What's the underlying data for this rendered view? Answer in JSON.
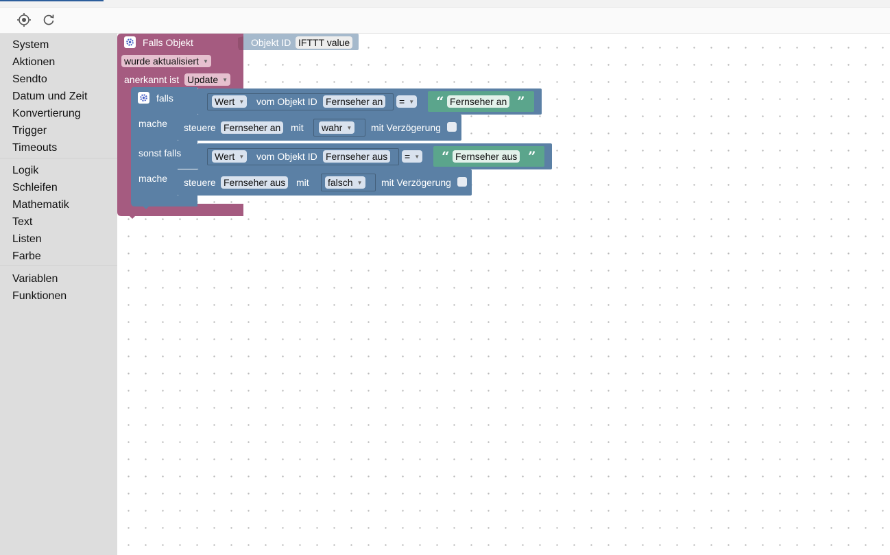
{
  "toolbar": {
    "icons": [
      "crosshair-icon",
      "refresh-icon"
    ]
  },
  "sidebar": {
    "groups": [
      [
        "System",
        "Aktionen",
        "Sendto",
        "Datum und Zeit",
        "Konvertierung",
        "Trigger",
        "Timeouts"
      ],
      [
        "Logik",
        "Schleifen",
        "Mathematik",
        "Text",
        "Listen",
        "Farbe"
      ],
      [
        "Variablen",
        "Funktionen"
      ]
    ]
  },
  "colors": {
    "trigger_block": "#a55b80",
    "logic_block": "#5b80a5",
    "text_block": "#5ba58c",
    "objekt_id_block": "#a5b9cc",
    "sidebar_bg": "#dddddd"
  },
  "trigger": {
    "title": "Falls Objekt",
    "event": "wurde aktualisiert",
    "ack_label": "anerkannt ist",
    "ack_value": "Update",
    "objekt_id_label": "Objekt ID",
    "objekt_id_value": "IFTTT value"
  },
  "if_block": {
    "falls": "falls",
    "mache": "mache",
    "sonst_falls": "sonst falls",
    "branch1": {
      "wert": "Wert",
      "vom_label": "vom Objekt ID",
      "object": "Fernseher an",
      "op": "=",
      "text": "Fernseher an",
      "steuere": "steuere",
      "target": "Fernseher an",
      "mit": "mit",
      "value": "wahr",
      "delay_label": "mit Verzögerung"
    },
    "branch2": {
      "wert": "Wert",
      "vom_label": "vom Objekt ID",
      "object": "Fernseher aus",
      "op": "=",
      "text": "Fernseher aus",
      "steuere": "steuere",
      "target": "Fernseher aus",
      "mit": "mit",
      "value": "falsch",
      "delay_label": "mit Verzögerung"
    }
  },
  "quotes": {
    "open": "“",
    "close": "”"
  }
}
